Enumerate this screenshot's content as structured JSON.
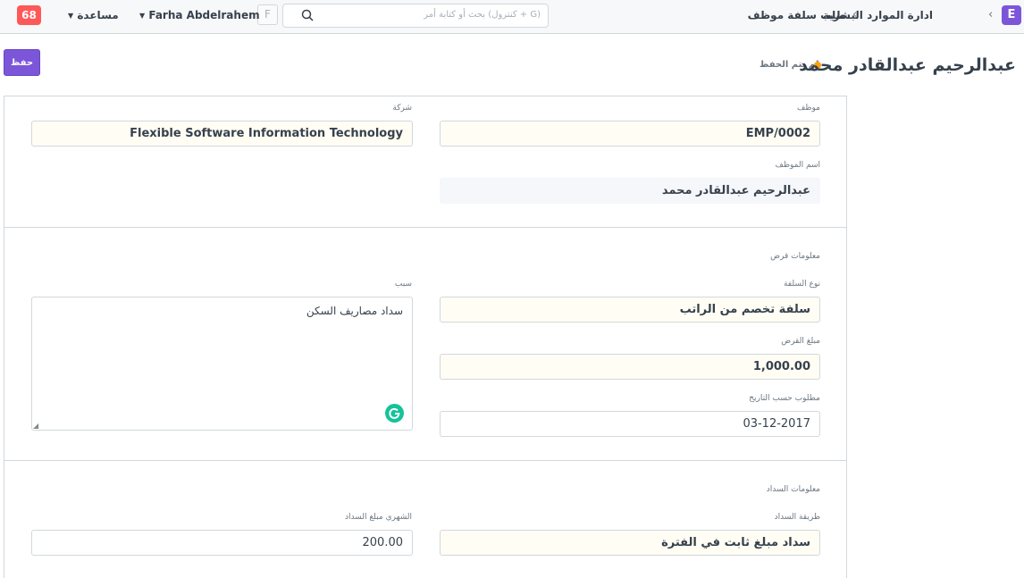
{
  "navbar": {
    "logo_letter": "E",
    "breadcrumbs": [
      "ادارة الموارد البشرية",
      "طلب سلفة موظف"
    ],
    "search_placeholder": "بحث أو كتابة أمر (كنترول + G)",
    "avatar_letter": "F",
    "user_name": "Farha Abdelrahem",
    "help_label": "مساعدة",
    "notifications_count": "68"
  },
  "header": {
    "title": "عبدالرحيم عبدالقادر محمد",
    "status": "لم يتم الحفظ",
    "save_label": "حفظ",
    "status_color": "#ffa00a"
  },
  "form": {
    "employee": {
      "label": "موظف",
      "value": "EMP/0002"
    },
    "company": {
      "label": "شركة",
      "value": "Flexible Software Information Technology"
    },
    "employee_name": {
      "label": "اسم الموظف",
      "value": "عبدالرحيم عبدالقادر محمد"
    },
    "loan_section": "معلومات قرض",
    "advance_type": {
      "label": "نوع السلفة",
      "value": "سلفة تخصم من الراتب"
    },
    "reason": {
      "label": "سبب",
      "value": "سداد مصاريف السكن"
    },
    "loan_amount": {
      "label": "مبلغ القرض",
      "value": "1,000.00"
    },
    "required_by_date": {
      "label": "مطلوب حسب التاريخ",
      "value": "03-12-2017"
    },
    "repayment_section": "معلومات السداد",
    "repayment_method": {
      "label": "طريقة السداد",
      "value": "سداد مبلغ ثابت في الفترة"
    },
    "monthly_repayment": {
      "label": "الشهري مبلغ السداد",
      "value": "200.00"
    }
  }
}
